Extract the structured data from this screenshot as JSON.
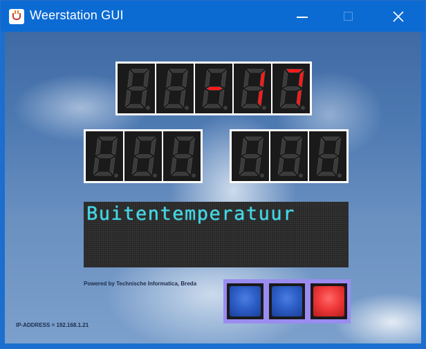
{
  "window": {
    "title": "Weerstation GUI",
    "controls": {
      "minimize_icon": "minimize-icon",
      "maximize_icon": "maximize-icon",
      "close_icon": "close-icon"
    },
    "app_icon": "java-cup-icon"
  },
  "display": {
    "top_row": [
      "",
      "",
      "-",
      "1",
      "7"
    ],
    "bottom_left": [
      "",
      "",
      ""
    ],
    "bottom_right": [
      "",
      "",
      ""
    ],
    "lit_color": "#ff1a1a",
    "unlit_color": "#3a3a3a"
  },
  "matrix": {
    "text": "Buitentemperatuur",
    "color": "#3fd8e8"
  },
  "footer": {
    "powered_by": "Powered by Technische Informatica,  Breda",
    "ip_address": "IP-ADDRESS = 192.168.1.21"
  },
  "buttons": [
    {
      "color": "blue"
    },
    {
      "color": "blue"
    },
    {
      "color": "red"
    }
  ]
}
